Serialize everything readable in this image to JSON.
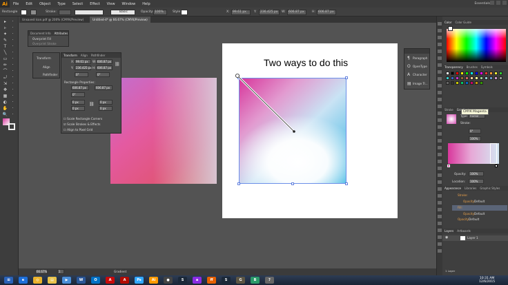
{
  "app": {
    "logo": "Ai",
    "menu": [
      "File",
      "Edit",
      "Object",
      "Type",
      "Select",
      "Effect",
      "View",
      "Window",
      "Help"
    ],
    "workspace": "Essentials"
  },
  "control_bar": {
    "selection": "Rectangle",
    "stroke_label": "Stroke:",
    "weight": "Basic",
    "opacity_label": "Opacity:",
    "opacity": "100%",
    "style_label": "Style:",
    "x_label": "X:",
    "x": "99.61 px",
    "y_label": "Y:",
    "y": "236.425 px",
    "w_label": "W:",
    "w": "606.87 px",
    "h_label": "H:",
    "h": "606.87 px"
  },
  "tabs": [
    {
      "label": "Unsaved Icon.pdf @ 200% (CMYK/Preview)",
      "active": false
    },
    {
      "label": "Untitled-4* @ 66.67% (CMYK/Preview)",
      "active": true
    }
  ],
  "doc_info_panel": {
    "tabs": [
      "Document Info",
      "Attributes"
    ],
    "rows": [
      "Overprint Fill",
      "Overprint Stroke"
    ]
  },
  "transform_mini": {
    "items": [
      "Transform",
      "Align",
      "Pathfinder"
    ]
  },
  "transform_panel": {
    "tabs": [
      "Transform",
      "Align",
      "Pathfinder"
    ],
    "x_label": "X:",
    "x": "99.61 px",
    "w_label": "W:",
    "w": "606.87 px",
    "y_label": "Y:",
    "y": "236.425 px",
    "h_label": "H:",
    "h": "606.87 px",
    "angle": "0°",
    "shear": "0°",
    "rect_props": "Rectangle Properties:",
    "rw": "606.87 px",
    "rh": "606.87 px",
    "r_angle": "0°",
    "corners": [
      "0 px",
      "0 px",
      "0 px",
      "0 px"
    ],
    "checks": [
      {
        "label": "Scale Rectangle Corners",
        "checked": false
      },
      {
        "label": "Scale Strokes & Effects",
        "checked": true
      },
      {
        "label": "Align to Pixel Grid",
        "checked": false
      }
    ]
  },
  "canvas": {
    "headline": "Two ways to do this"
  },
  "char_panel": {
    "items": [
      "Paragraph",
      "OpenType",
      "Character",
      "Image Tr..."
    ]
  },
  "right_panels": {
    "color_tabs": [
      "Color",
      "Color Guide"
    ],
    "transp_tabs": [
      "Transparency",
      "Brushes",
      "Symbols"
    ],
    "stroke_tabs": [
      "Stroke",
      "Gradient"
    ],
    "grad_type_label": "Type:",
    "grad_type": "Radial",
    "stroke_label": "Stroke:",
    "angle": "0°",
    "aspect": "100%",
    "opacity_label": "Opacity:",
    "opacity": "100%",
    "location_label": "Location:",
    "location": "100%",
    "tooltip": "CMYK Magenta",
    "appear_tabs": [
      "Appearance",
      "Libraries",
      "Graphic Styles"
    ],
    "appear_rows": [
      {
        "label": "Stroke:",
        "val": ""
      },
      {
        "label": "Opacity:",
        "val": "Default"
      },
      {
        "label": "Fill:",
        "val": ""
      },
      {
        "label": "Opacity:",
        "val": "Default"
      },
      {
        "label": "Opacity:",
        "val": "Default"
      }
    ],
    "layers_tabs": [
      "Layers",
      "Artboards"
    ],
    "layer": "Layer 1",
    "layers_count": "1 Layer"
  },
  "status": {
    "zoom": "66.67%",
    "page": "1",
    "tool": "Gradient"
  },
  "taskbar": {
    "icons": [
      "start",
      "ie",
      "chrome",
      "folder",
      "media",
      "word",
      "outlook",
      "acrobat",
      "acrobat-dc",
      "photoshop",
      "illustrator",
      "obs",
      "steam",
      "app",
      "firefox",
      "steam2",
      "gimp",
      "bandicam",
      "misc"
    ],
    "time": "10:31 AM",
    "date": "12/6/2015"
  }
}
